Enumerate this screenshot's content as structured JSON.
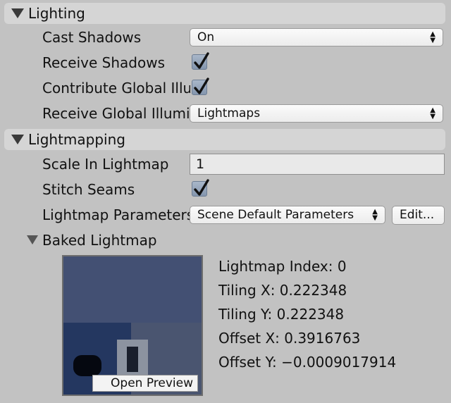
{
  "lighting": {
    "header": "Lighting",
    "cast_shadows_label": "Cast Shadows",
    "cast_shadows_value": "On",
    "receive_shadows_label": "Receive Shadows",
    "receive_shadows_checked": true,
    "contribute_gi_label": "Contribute Global Illumination",
    "contribute_gi_checked": true,
    "receive_gi_label": "Receive Global Illumination",
    "receive_gi_value": "Lightmaps"
  },
  "lightmapping": {
    "header": "Lightmapping",
    "scale_label": "Scale In Lightmap",
    "scale_value": "1",
    "stitch_label": "Stitch Seams",
    "stitch_checked": true,
    "params_label": "Lightmap Parameters",
    "params_value": "Scene Default Parameters",
    "edit_button": "Edit..."
  },
  "baked": {
    "header": "Baked Lightmap",
    "open_preview": "Open Preview",
    "index": "Lightmap Index: 0",
    "tiling_x": "Tiling X: 0.222348",
    "tiling_y": "Tiling Y: 0.222348",
    "offset_x": "Offset X: 0.3916763",
    "offset_y": "Offset Y: −0.0009017914"
  },
  "colors": {
    "checkbox": "#8f9fb5",
    "preview_bg": "#3f4a63"
  }
}
